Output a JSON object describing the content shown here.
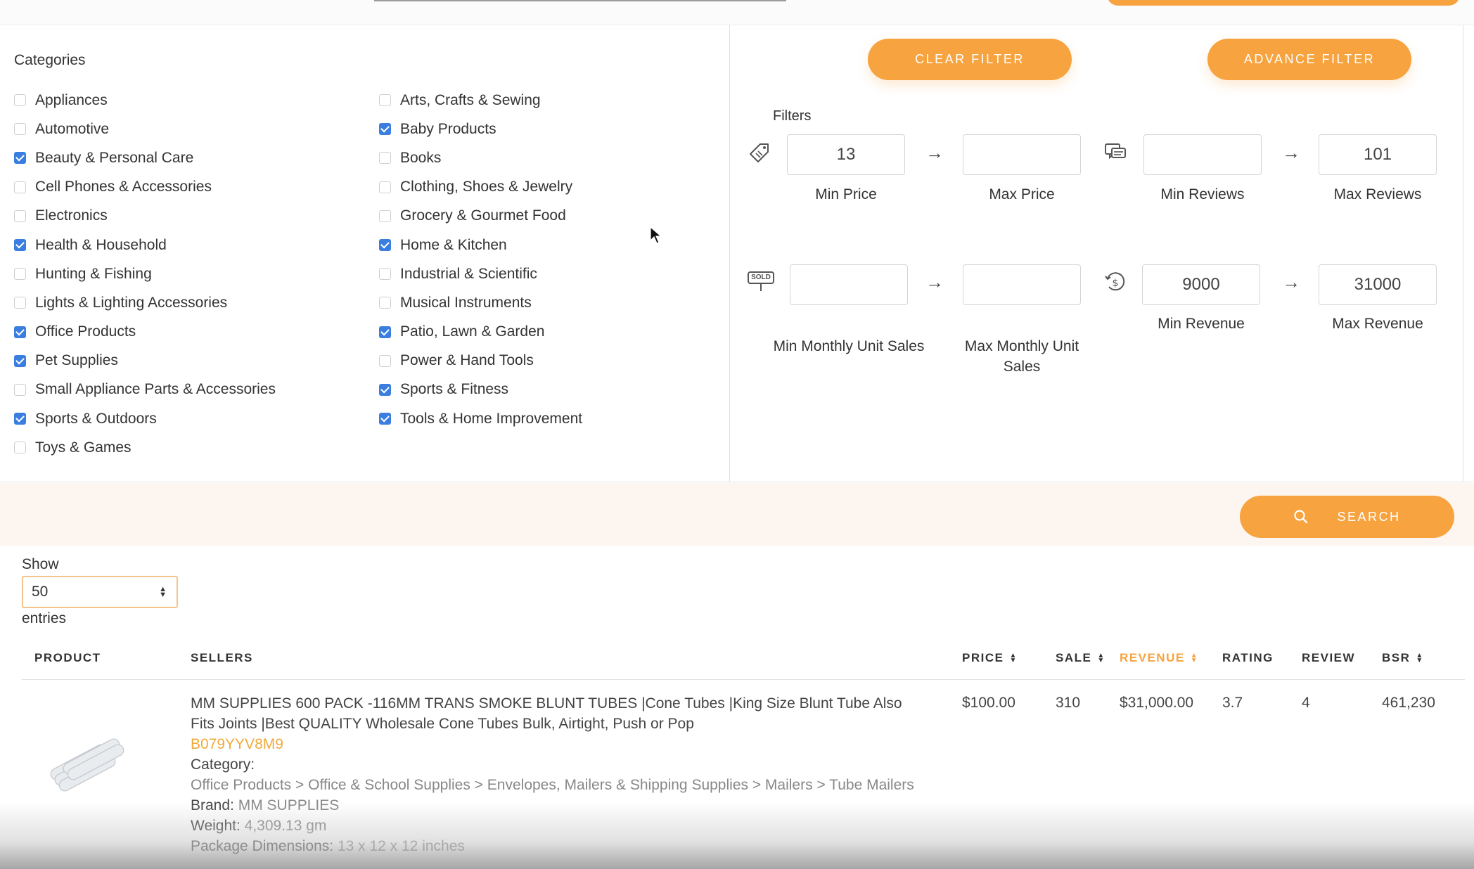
{
  "categories": {
    "title": "Categories",
    "col1": [
      {
        "label": "Appliances",
        "checked": false
      },
      {
        "label": "Automotive",
        "checked": false
      },
      {
        "label": "Beauty & Personal Care",
        "checked": true
      },
      {
        "label": "Cell Phones & Accessories",
        "checked": false
      },
      {
        "label": "Electronics",
        "checked": false
      },
      {
        "label": "Health & Household",
        "checked": true
      },
      {
        "label": "Hunting & Fishing",
        "checked": false
      },
      {
        "label": "Lights & Lighting Accessories",
        "checked": false
      },
      {
        "label": "Office Products",
        "checked": true
      },
      {
        "label": "Pet Supplies",
        "checked": true
      },
      {
        "label": "Small Appliance Parts & Accessories",
        "checked": false
      },
      {
        "label": "Sports & Outdoors",
        "checked": true
      },
      {
        "label": "Toys & Games",
        "checked": false
      }
    ],
    "col2": [
      {
        "label": "Arts, Crafts & Sewing",
        "checked": false
      },
      {
        "label": "Baby Products",
        "checked": true
      },
      {
        "label": "Books",
        "checked": false
      },
      {
        "label": "Clothing, Shoes & Jewelry",
        "checked": false
      },
      {
        "label": "Grocery & Gourmet Food",
        "checked": false
      },
      {
        "label": "Home & Kitchen",
        "checked": true
      },
      {
        "label": "Industrial & Scientific",
        "checked": false
      },
      {
        "label": "Musical Instruments",
        "checked": false
      },
      {
        "label": "Patio, Lawn & Garden",
        "checked": true
      },
      {
        "label": "Power & Hand Tools",
        "checked": false
      },
      {
        "label": "Sports & Fitness",
        "checked": true
      },
      {
        "label": "Tools & Home Improvement",
        "checked": true
      }
    ]
  },
  "filters": {
    "clear_label": "CLEAR FILTER",
    "advance_label": "ADVANCE FILTER",
    "title": "Filters",
    "min_price": {
      "value": "13",
      "label": "Min Price"
    },
    "max_price": {
      "value": "",
      "label": "Max Price"
    },
    "min_reviews": {
      "value": "",
      "label": "Min Reviews"
    },
    "max_reviews": {
      "value": "101",
      "label": "Max Reviews"
    },
    "min_unit_sales": {
      "value": "",
      "label": "Min Monthly Unit Sales"
    },
    "max_unit_sales": {
      "value": "",
      "label": "Max Monthly Unit Sales"
    },
    "min_revenue": {
      "value": "9000",
      "label": "Min Revenue"
    },
    "max_revenue": {
      "value": "31000",
      "label": "Max Revenue"
    },
    "arrow": "→",
    "sold_icon_text": "SOLD"
  },
  "search": {
    "label": "SEARCH"
  },
  "entries": {
    "show": "Show",
    "selected": "50",
    "suffix": "entries"
  },
  "table": {
    "headers": {
      "product": "PRODUCT",
      "sellers": "SELLERS",
      "price": "PRICE",
      "sale": "SALE",
      "revenue": "REVENUE",
      "rating": "RATING",
      "review": "REVIEW",
      "bsr": "BSR"
    },
    "rows": [
      {
        "title": "MM SUPPLIES 600 PACK -116MM TRANS SMOKE BLUNT TUBES |Cone Tubes |King Size Blunt Tube Also Fits Joints |Best QUALITY Wholesale Cone Tubes Bulk, Airtight, Push or Pop",
        "asin": "B079YYV8M9",
        "category_label": "Category:",
        "category_path": "Office Products > Office & School Supplies > Envelopes, Mailers & Shipping Supplies > Mailers > Tube Mailers",
        "brand_label": "Brand:",
        "brand": "MM SUPPLIES",
        "weight_label": "Weight:",
        "weight": "4,309.13 gm",
        "dims_label": "Package Dimensions:",
        "dims": "13 x 12 x 12 inches",
        "price": "$100.00",
        "sale": "310",
        "revenue": "$31,000.00",
        "rating": "3.7",
        "review": "4",
        "bsr": "461,230"
      }
    ]
  },
  "colors": {
    "accent": "#f7a33f",
    "checkbox": "#3a7ee0",
    "asin": "#f0a93b"
  }
}
